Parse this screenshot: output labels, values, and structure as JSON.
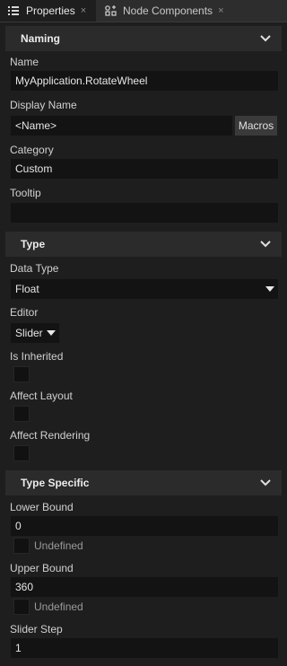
{
  "tabs": [
    {
      "label": "Properties",
      "icon": "list-icon",
      "close": "×"
    },
    {
      "label": "Node Components",
      "icon": "components-icon",
      "close": "×"
    }
  ],
  "sections": {
    "naming": "Naming",
    "type": "Type",
    "type_specific": "Type Specific"
  },
  "naming": {
    "name_label": "Name",
    "name_value": "MyApplication.RotateWheel",
    "display_name_label": "Display Name",
    "display_name_value": "<Name>",
    "macros_label": "Macros",
    "category_label": "Category",
    "category_value": "Custom",
    "tooltip_label": "Tooltip",
    "tooltip_value": ""
  },
  "type": {
    "data_type_label": "Data Type",
    "data_type_value": "Float",
    "editor_label": "Editor",
    "editor_value": "Slider",
    "is_inherited_label": "Is Inherited",
    "is_inherited_checked": false,
    "affect_layout_label": "Affect Layout",
    "affect_layout_checked": false,
    "affect_rendering_label": "Affect Rendering",
    "affect_rendering_checked": false
  },
  "type_specific": {
    "lower_bound_label": "Lower Bound",
    "lower_bound_value": "0",
    "lower_undefined_label": "Undefined",
    "lower_undefined_checked": false,
    "upper_bound_label": "Upper Bound",
    "upper_bound_value": "360",
    "upper_undefined_label": "Undefined",
    "upper_undefined_checked": false,
    "slider_step_label": "Slider Step",
    "slider_step_value": "1"
  },
  "colors": {
    "background": "#1e1e1e",
    "section_header": "#2b2b2b",
    "field": "#131313",
    "button": "#3a3a3a"
  }
}
